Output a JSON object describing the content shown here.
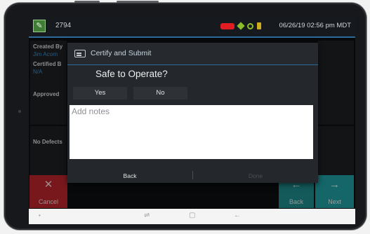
{
  "statusbar": {
    "unit_number": "2794",
    "datetime": "06/26/19 02:56 pm MDT",
    "icons": [
      "truck-icon",
      "diamond-status-icon",
      "gps-icon",
      "power-plug-icon"
    ],
    "colors": {
      "truck": "#e11d24",
      "status_green": "#8bbf2a",
      "power": "#cfae1e",
      "accent": "#2b6a9a"
    }
  },
  "background": {
    "created_by_label": "Created By",
    "created_by_value": "Jim Acorn",
    "certified_by_label": "Certified B",
    "certified_by_value": "N/A",
    "approved_label": "Approved",
    "defects_label": "No Defects"
  },
  "nav": {
    "cancel_label": "Cancel",
    "back_label": "Back",
    "next_label": "Next"
  },
  "dialog": {
    "title": "Certify and Submit",
    "question": "Safe to Operate?",
    "yes_label": "Yes",
    "no_label": "No",
    "notes_placeholder": "Add notes",
    "notes_value": "",
    "back_label": "Back",
    "done_label": "Done"
  }
}
